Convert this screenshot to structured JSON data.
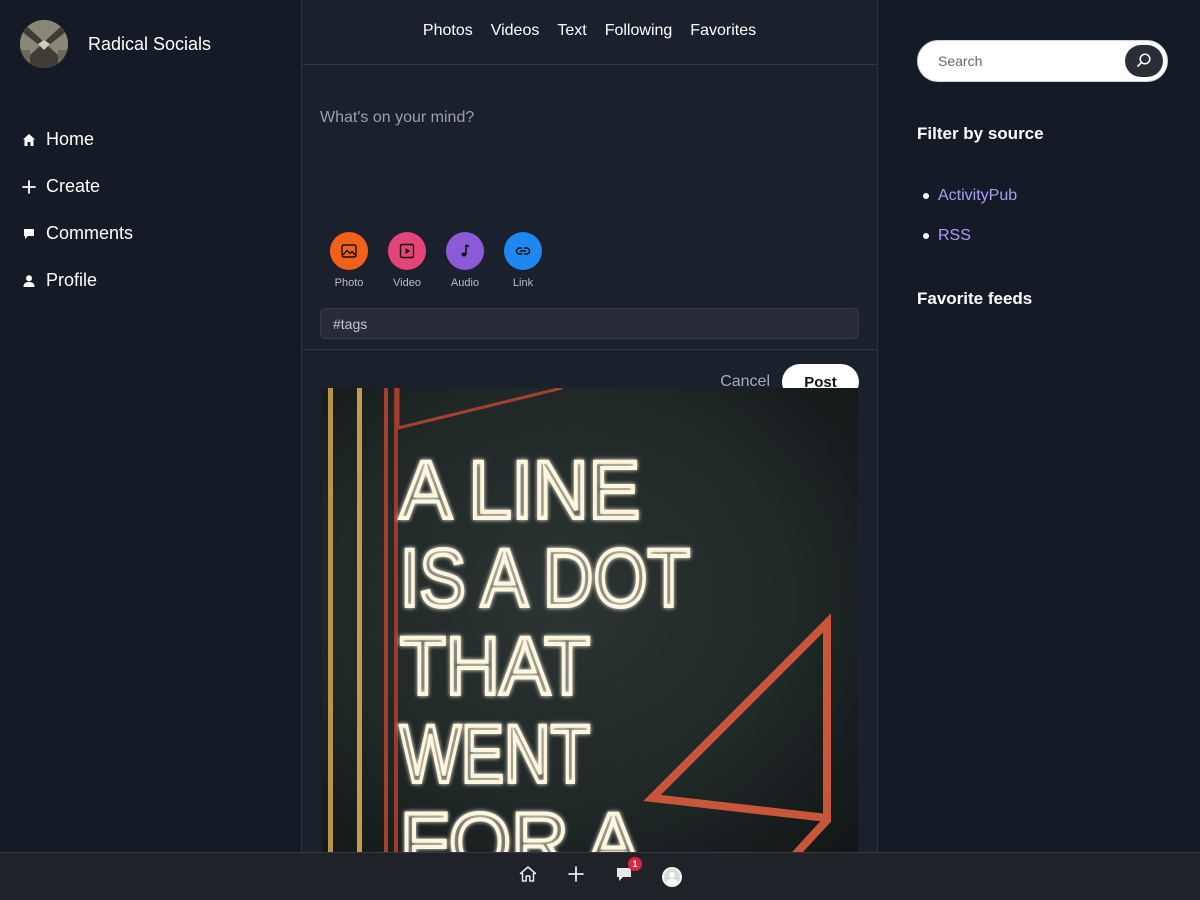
{
  "app": {
    "name": "Radical Socials"
  },
  "sidebar": {
    "items": [
      {
        "label": "Home",
        "icon": "home-icon"
      },
      {
        "label": "Create",
        "icon": "plus-icon"
      },
      {
        "label": "Comments",
        "icon": "comment-icon"
      },
      {
        "label": "Profile",
        "icon": "user-icon"
      }
    ]
  },
  "tabs": [
    "Photos",
    "Videos",
    "Text",
    "Following",
    "Favorites"
  ],
  "composer": {
    "placeholder": "What's on your mind?",
    "media": [
      {
        "label": "Photo",
        "icon": "image-icon",
        "color": "#f2611a"
      },
      {
        "label": "Video",
        "icon": "play-icon",
        "color": "#e44478"
      },
      {
        "label": "Audio",
        "icon": "music-note-icon",
        "color": "#8d5ad7"
      },
      {
        "label": "Link",
        "icon": "link-icon",
        "color": "#1f87f0"
      }
    ],
    "tags_placeholder": "#tags",
    "cancel_label": "Cancel",
    "post_label": "Post"
  },
  "post": {
    "image_text_lines": [
      "A LINE",
      "IS A DOT",
      "THAT",
      "WENT",
      "FOR A"
    ]
  },
  "search": {
    "placeholder": "Search"
  },
  "filter": {
    "heading": "Filter by source",
    "sources": [
      "ActivityPub",
      "RSS"
    ]
  },
  "favorites": {
    "heading": "Favorite feeds"
  },
  "bottom_bar": {
    "notification_count": "1"
  },
  "colors": {
    "background": "#151a27",
    "panel": "#1b202d",
    "link": "#a99ff5",
    "badge": "#e0243a"
  }
}
